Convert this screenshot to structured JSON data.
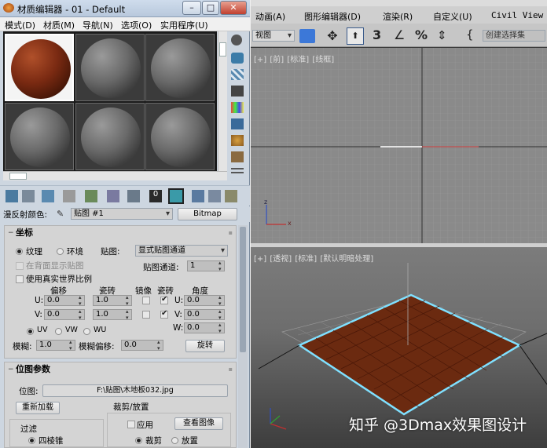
{
  "material_editor": {
    "title": "材质编辑器 - 01 - Default",
    "menu": [
      "模式(D)",
      "材质(M)",
      "导航(N)",
      "选项(O)",
      "实用程序(U)"
    ],
    "diffuse": {
      "label": "漫反射颜色:",
      "map_name": "贴图 #1",
      "map_type": "Bitmap"
    },
    "coordinates": {
      "header": "坐标",
      "texture_label": "纹理",
      "environ_label": "环境",
      "mapping_label": "贴图:",
      "mapping_value": "显式贴图通道",
      "show_back_label": "在背面显示贴图",
      "map_channel_label": "贴图通道:",
      "map_channel_value": "1",
      "real_world_label": "使用真实世界比例",
      "col_offset": "偏移",
      "col_tiling": "瓷砖",
      "col_mirror": "镜像",
      "col_tile": "瓷砖",
      "col_angle": "角度",
      "u_label": "U:",
      "v_label": "V:",
      "w_label": "W:",
      "u_offset": "0.0",
      "v_offset": "0.0",
      "u_tiling": "1.0",
      "v_tiling": "1.0",
      "u_angle": "0.0",
      "v_angle": "0.0",
      "w_angle": "0.0",
      "uv_label": "UV",
      "vw_label": "VW",
      "wu_label": "WU",
      "blur_label": "模糊:",
      "blur_value": "1.0",
      "blur_offset_label": "模糊偏移:",
      "blur_offset_value": "0.0",
      "rotate_label": "旋转"
    },
    "bitmap_params": {
      "header": "位图参数",
      "bitmap_label": "位图:",
      "bitmap_path": "F:\\贴图\\木地板032.jpg",
      "reload_label": "重新加载",
      "crop_place_label": "裁剪/放置",
      "filter_label": "过滤",
      "apply_label": "应用",
      "view_image_label": "查看图像",
      "pyramid_label": "四棱锥",
      "crop_label": "裁剪",
      "place_label": "放置"
    }
  },
  "max": {
    "menu": [
      "动画(A)",
      "图形编辑器(D)",
      "渲染(R)",
      "自定义(U)",
      "Civil View"
    ],
    "view_dropdown": "视图",
    "selection_set": "创建选择集",
    "top_viewport_label": "[+] [前] [标准] [线框]",
    "persp_viewport_label": "[+] [透视] [标准] [默认明暗处理]",
    "watermark": "知乎 @3Dmax效果图设计"
  },
  "colors": {
    "accent_blue": "#3c78d8",
    "floor_wood": "#6b2a10",
    "floor_outline": "#7fe0ff"
  }
}
